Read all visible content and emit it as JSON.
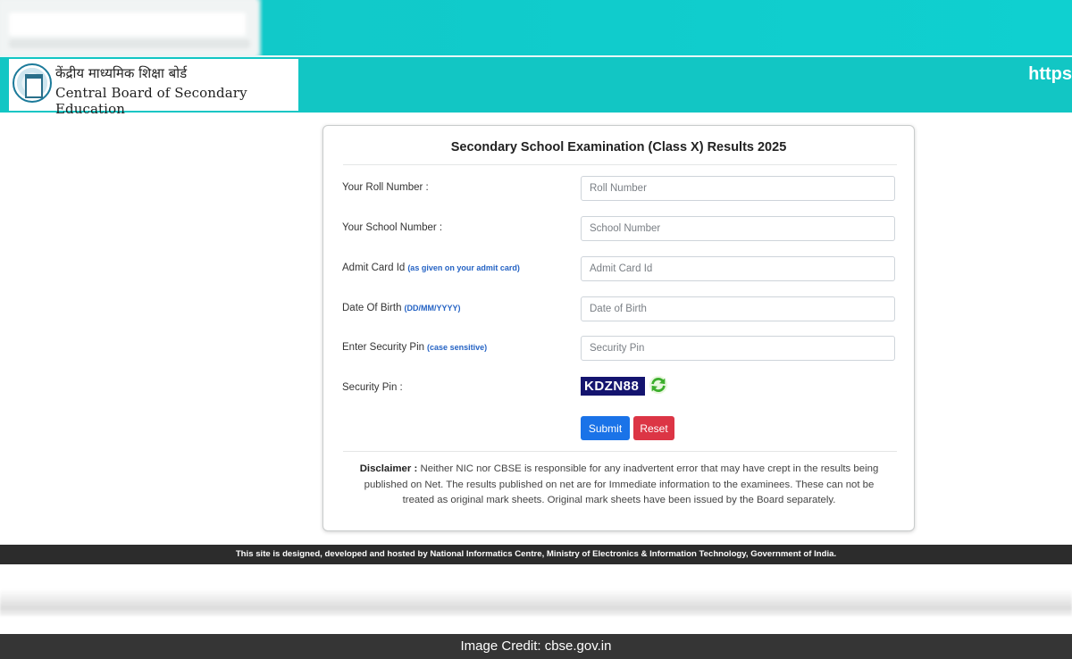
{
  "header": {
    "logo_hindi": "केंद्रीय माध्यमिक शिक्षा बोर्ड",
    "logo_english": "Central Board of Secondary Education",
    "url_fragment": "https"
  },
  "form": {
    "title": "Secondary School Examination (Class X) Results 2025",
    "rows": [
      {
        "label": "Your Roll Number :",
        "hint": "",
        "placeholder": "Roll Number"
      },
      {
        "label": "Your School Number :",
        "hint": "",
        "placeholder": "School Number"
      },
      {
        "label": "Admit Card Id",
        "hint": "(as given on your admit card)",
        "placeholder": "Admit Card Id"
      },
      {
        "label": "Date Of Birth",
        "hint": "(DD/MM/YYYY)",
        "placeholder": "Date of Birth"
      },
      {
        "label": "Enter Security Pin",
        "hint": "(case sensitive)",
        "placeholder": "Security Pin"
      }
    ],
    "security_pin_label": "Security Pin :",
    "captcha_code": "KDZN88",
    "submit_label": "Submit",
    "reset_label": "Reset",
    "disclaimer_heading": "Disclaimer :",
    "disclaimer_text": "Neither NIC nor CBSE is responsible for any inadvertent error that may have crept in the results being published on Net. The results published on net are for Immediate information to the examinees. These can not be treated as original mark sheets. Original mark sheets have been issued by the Board separately."
  },
  "footer": {
    "text": "This site is designed, developed and hosted by National Informatics Centre, Ministry of Electronics & Information Technology, Government of India."
  },
  "credit": {
    "text": "Image Credit: cbse.gov.in"
  },
  "colors": {
    "header_teal": "#12c6c4",
    "captcha_bg": "#14146f",
    "submit_blue": "#1a73e8",
    "reset_red": "#dc3545",
    "hint_blue": "#2563c4"
  },
  "icons": {
    "seal": "cbse-seal-icon",
    "refresh": "refresh-icon"
  }
}
